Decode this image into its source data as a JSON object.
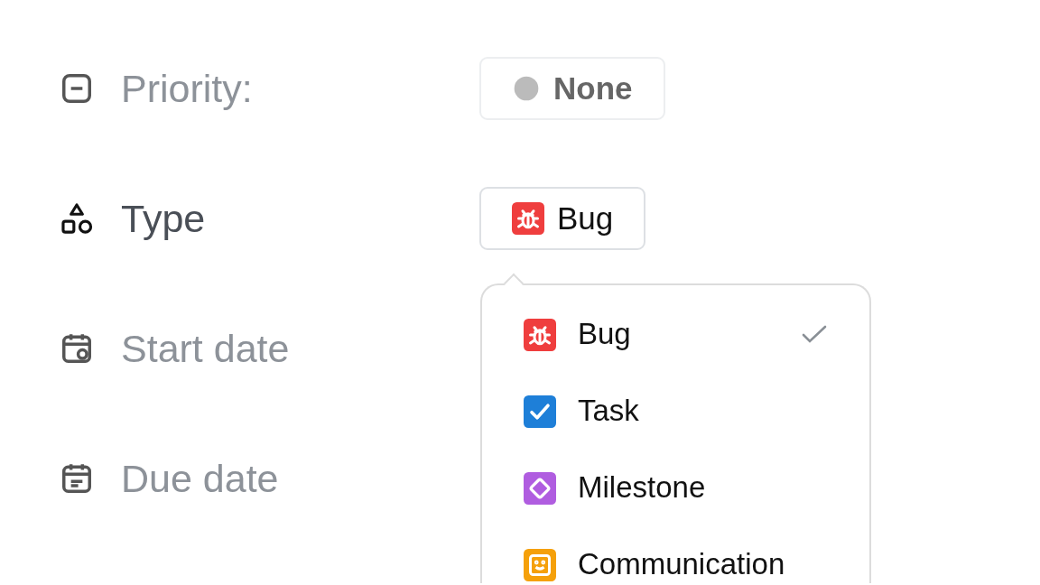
{
  "fields": [
    {
      "kind": "priority",
      "label": "Priority:",
      "value": "None",
      "blurred": true
    },
    {
      "kind": "type",
      "label": "Type",
      "value": "Bug",
      "blurred": false,
      "dropdown": {
        "options": [
          {
            "kind": "bug",
            "label": "Bug",
            "color": "#ef3e3e",
            "selected": true
          },
          {
            "kind": "task",
            "label": "Task",
            "color": "#1e7fd8",
            "selected": false
          },
          {
            "kind": "milestone",
            "label": "Milestone",
            "color": "#b05de0",
            "selected": false
          },
          {
            "kind": "communication",
            "label": "Communication",
            "color": "#f5a00a",
            "selected": false
          }
        ]
      }
    },
    {
      "kind": "start_date",
      "label": "Start date",
      "blurred": true
    },
    {
      "kind": "due_date",
      "label": "Due date",
      "blurred": true
    }
  ]
}
